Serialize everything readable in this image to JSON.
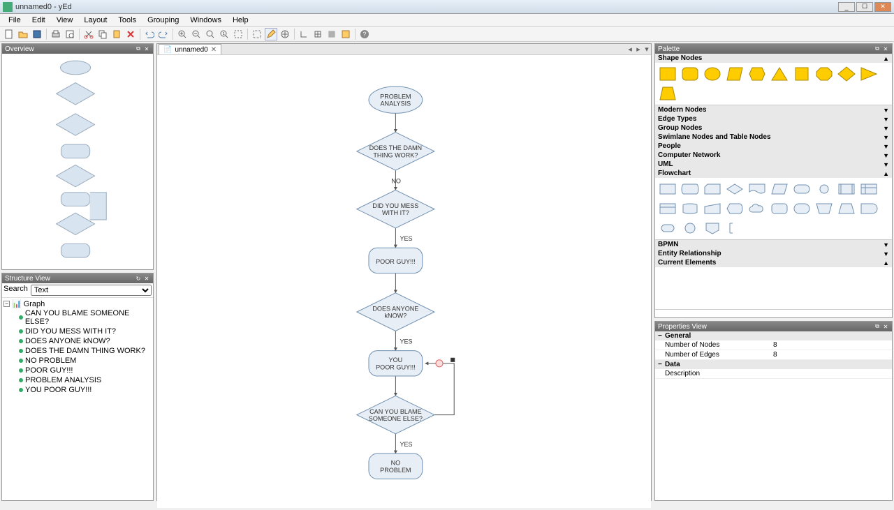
{
  "window": {
    "title": "unnamed0 - yEd"
  },
  "menu": {
    "file": "File",
    "edit": "Edit",
    "view": "View",
    "layout": "Layout",
    "tools": "Tools",
    "grouping": "Grouping",
    "windows": "Windows",
    "help": "Help"
  },
  "tabs": {
    "name": "unnamed0"
  },
  "overview": {
    "title": "Overview"
  },
  "structure": {
    "title": "Structure View",
    "search_label": "Search",
    "search_mode": "Text",
    "root": "Graph",
    "items": [
      "CAN YOU BLAME SOMEONE ELSE?",
      "DID YOU MESS WITH IT?",
      "DOES ANYONE kNOW?",
      "DOES THE DAMN THING WORK?",
      "NO PROBLEM",
      "POOR GUY!!!",
      "PROBLEM ANALYSIS",
      "YOU POOR GUY!!!"
    ]
  },
  "palette": {
    "title": "Palette",
    "sections": {
      "shape": "Shape Nodes",
      "modern": "Modern Nodes",
      "edge": "Edge Types",
      "group": "Group Nodes",
      "swim": "Swimlane Nodes and Table Nodes",
      "people": "People",
      "net": "Computer Network",
      "uml": "UML",
      "flow": "Flowchart",
      "bpmn": "BPMN",
      "entity": "Entity Relationship",
      "current": "Current Elements"
    }
  },
  "properties": {
    "title": "Properties View",
    "groups": {
      "general": "General",
      "data": "Data"
    },
    "rows": {
      "nodes_label": "Number of Nodes",
      "nodes_val": "8",
      "edges_label": "Number of Edges",
      "edges_val": "8",
      "desc_label": "Description",
      "desc_val": ""
    }
  },
  "flow": {
    "n1": "PROBLEM\nANALYSIS",
    "n2": "DOES THE DAMN\nTHING WORK?",
    "n3": "DID YOU MESS\nWITH IT?",
    "n4": "POOR GUY!!!",
    "n5": "DOES ANYONE\nkNOW?",
    "n6": "YOU\nPOOR GUY!!!",
    "n7": "CAN YOU BLAME\nSOMEONE ELSE?",
    "n8": "NO\nPROBLEM",
    "e_no": "NO",
    "e_yes_34": "YES",
    "e_yes_56": "YES",
    "e_yes_78": "YES"
  }
}
